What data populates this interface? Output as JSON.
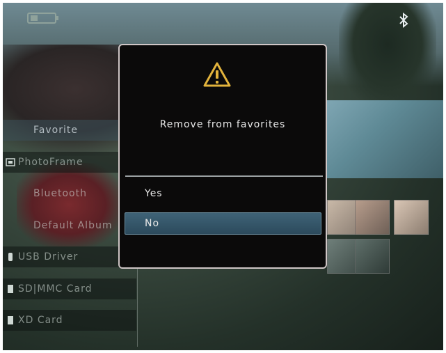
{
  "status_bar": {
    "left_icon": "battery-icon",
    "right_icon": "bluetooth-icon"
  },
  "sidebar": {
    "items": [
      {
        "label": "Favorite",
        "icon": "",
        "state": "selected"
      },
      {
        "label": "PhotoFrame",
        "icon": "photoframe-icon",
        "state": "dark"
      },
      {
        "label": "Bluetooth",
        "icon": "",
        "state": "sub"
      },
      {
        "label": "Default Album",
        "icon": "",
        "state": "sub"
      },
      {
        "label": "USB Driver",
        "icon": "usb-icon",
        "state": "dark"
      },
      {
        "label": "SD|MMC Card",
        "icon": "card-icon",
        "state": "dark"
      },
      {
        "label": "XD Card",
        "icon": "card-icon",
        "state": "dark"
      }
    ]
  },
  "dialog": {
    "icon": "warning-icon",
    "message": "Remove from favorites",
    "options": [
      {
        "label": "Yes",
        "selected": false
      },
      {
        "label": "No",
        "selected": true
      }
    ]
  },
  "colors": {
    "dialog_bg": "#0b0a0a",
    "selected_option": "#355a6e",
    "warning": "#e2b33c"
  }
}
